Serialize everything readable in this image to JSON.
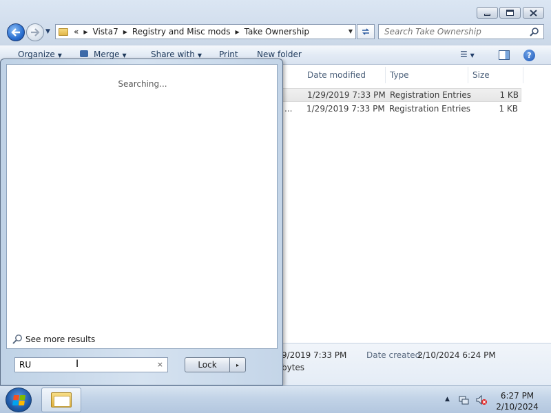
{
  "explorer": {
    "address": {
      "overflow": "«",
      "crumbs": [
        "Vista7",
        "Registry and Misc mods",
        "Take Ownership"
      ]
    },
    "search_placeholder": "Search Take Ownership",
    "toolbar": {
      "organize": "Organize",
      "merge": "Merge",
      "share_with": "Share with",
      "print": "Print",
      "new_folder": "New folder"
    },
    "columns": {
      "date_modified": "Date modified",
      "type": "Type",
      "size": "Size"
    },
    "files": [
      {
        "name": "",
        "date": "1/29/2019 7:33 PM",
        "type": "Registration Entries",
        "size": "1 KB",
        "selected": true
      },
      {
        "name": "...",
        "date": "1/29/2019 7:33 PM",
        "type": "Registration Entries",
        "size": "1 KB",
        "selected": false
      }
    ],
    "details": {
      "modified_value": "9/2019 7:33 PM",
      "created_label": "Date created:",
      "created_value": "2/10/2024 6:24 PM",
      "size_value": "bytes"
    }
  },
  "start_menu": {
    "status": "Searching...",
    "see_more": "See more results",
    "search_value": "RU",
    "clear_glyph": "×",
    "lock_label": "Lock",
    "lock_arrow": "▸"
  },
  "taskbar": {
    "time": "6:27 PM",
    "date": "2/10/2024"
  },
  "colors": {
    "accent": "#1f5aa8",
    "flag_red": "#f25022",
    "flag_green": "#7fba00",
    "flag_blue": "#00a4ef",
    "flag_yellow": "#ffb900"
  }
}
